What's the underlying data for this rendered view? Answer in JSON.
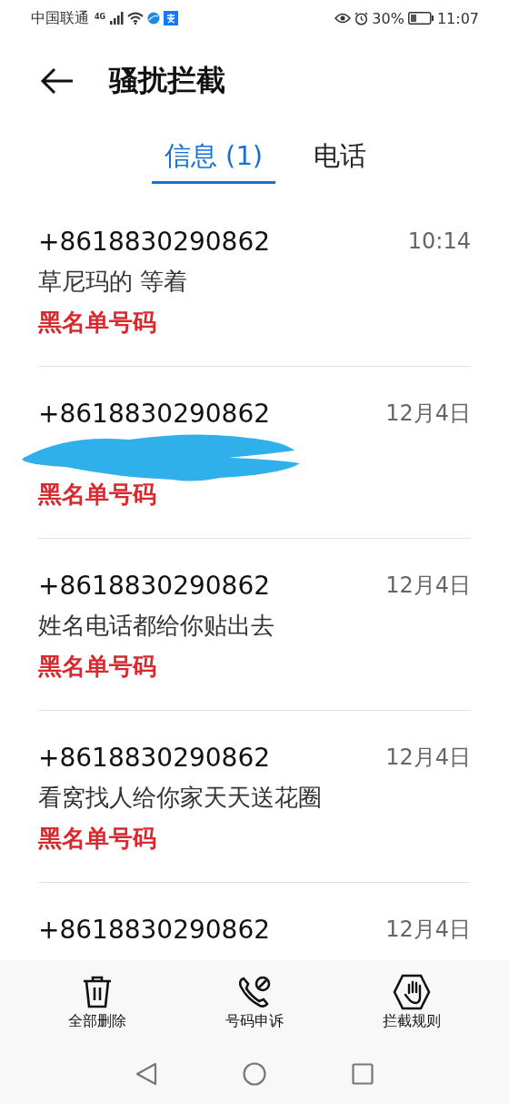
{
  "status_bar": {
    "carrier": "中国联通",
    "network_type": "4G",
    "battery_percent": "30%",
    "time": "11:07"
  },
  "header": {
    "title": "骚扰拦截"
  },
  "tabs": [
    {
      "label": "信息 (1)",
      "selected": true
    },
    {
      "label": "电话",
      "selected": false
    }
  ],
  "messages": [
    {
      "number": "+8618830290862",
      "time": "10:14",
      "preview": "草尼玛的 等着",
      "tag": "黑名单号码",
      "redacted": false
    },
    {
      "number": "+8618830290862",
      "time": "12月4日",
      "tag": "黑名单号码",
      "redacted": true
    },
    {
      "number": "+8618830290862",
      "time": "12月4日",
      "preview": "姓名电话都给你贴出去",
      "tag": "黑名单号码",
      "redacted": false
    },
    {
      "number": "+8618830290862",
      "time": "12月4日",
      "preview": "看窝找人给你家天天送花圈",
      "tag": "黑名单号码",
      "redacted": false
    },
    {
      "number": "+8618830290862",
      "time": "12月4日",
      "redacted": false
    }
  ],
  "actions": [
    {
      "kind": "delete",
      "label": "全部删除"
    },
    {
      "kind": "appeal",
      "label": "号码申诉"
    },
    {
      "kind": "rules",
      "label": "拦截规则"
    }
  ]
}
